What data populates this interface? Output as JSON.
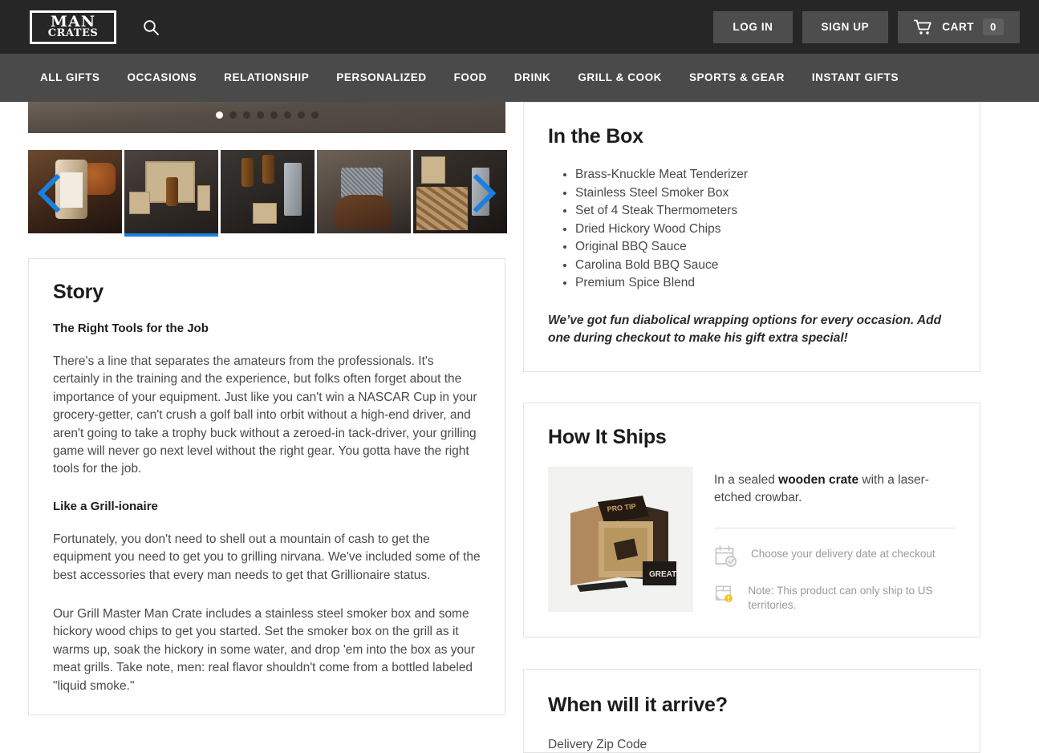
{
  "header": {
    "logo_line1": "MAN",
    "logo_line2": "CRATES",
    "search_icon": "search-icon",
    "login_label": "LOG IN",
    "signup_label": "SIGN UP",
    "cart_label": "CART",
    "cart_count": "0",
    "cart_icon": "shopping-cart-icon"
  },
  "nav": {
    "items": [
      {
        "label": "ALL GIFTS"
      },
      {
        "label": "OCCASIONS"
      },
      {
        "label": "RELATIONSHIP"
      },
      {
        "label": "PERSONALIZED"
      },
      {
        "label": "FOOD"
      },
      {
        "label": "DRINK"
      },
      {
        "label": "GRILL & COOK"
      },
      {
        "label": "SPORTS & GEAR"
      },
      {
        "label": "INSTANT GIFTS"
      }
    ]
  },
  "gallery": {
    "dot_count": 8,
    "active_dot_index": 0,
    "selected_thumb_index": 1,
    "prev_icon": "chevron-left-icon",
    "next_icon": "chevron-right-icon",
    "thumbs": [
      {
        "name": "spice-jar-with-meat"
      },
      {
        "name": "full-crate-contents"
      },
      {
        "name": "bbq-sauce-bottles-flatlay"
      },
      {
        "name": "hand-holding-meat-tenderizer"
      },
      {
        "name": "smoker-box-with-wood-chips"
      }
    ]
  },
  "story": {
    "heading": "Story",
    "sub1": "The Right Tools for the Job",
    "p1": "There's a line that separates the amateurs from the professionals. It's certainly in the training and the experience, but folks often forget about the importance of your equipment. Just like you can't win a NASCAR Cup in your grocery-getter, can't crush a golf ball into orbit without a high-end driver, and aren't going to take a trophy buck without a zeroed-in tack-driver, your grilling game will never go next level without the right gear. You gotta have the right tools for the job.",
    "sub2": "Like a Grill-ionaire",
    "p2": "Fortunately, you don't need to shell out a mountain of cash to get the equipment you need to get you to grilling nirvana. We've included some of the best accessories that every man needs to get that Grillionaire status.",
    "p3": "Our Grill Master Man Crate includes a stainless steel smoker box and some hickory wood chips to get you started. Set the smoker box on the grill as it warms up, soak the hickory in some water, and drop 'em into the box as your meat grills. Take note, men: real flavor shouldn't come from a bottled labeled \"liquid smoke.\""
  },
  "in_the_box": {
    "heading": "In the Box",
    "items": [
      "Brass-Knuckle Meat Tenderizer",
      "Stainless Steel Smoker Box",
      "Set of 4 Steak Thermometers",
      "Dried Hickory Wood Chips",
      "Original BBQ Sauce",
      "Carolina Bold BBQ Sauce",
      "Premium Spice Blend"
    ],
    "wrapping_note": "We’ve got fun diabolical wrapping options for every occasion. Add one during checkout to make his gift extra special!"
  },
  "how_it_ships": {
    "heading": "How It Ships",
    "image_name": "wooden-crate-in-box",
    "lead_before": "In a sealed ",
    "lead_bold": "wooden crate",
    "lead_after": " with a laser-etched crowbar.",
    "lines": [
      {
        "icon": "calendar-check-icon",
        "text": "Choose your delivery date at checkout"
      },
      {
        "icon": "box-warning-icon",
        "text": "Note: This product can only ship to US territories."
      }
    ]
  },
  "arrival": {
    "heading": "When will it arrive?",
    "zip_label": "Delivery Zip Code"
  },
  "colors": {
    "topbar": "#262626",
    "nav": "#4a4a4a",
    "accent_blue": "#1b7fe0",
    "warning_yellow": "#f5c518",
    "body_text": "#4a4a4a",
    "heading_text": "#1c1c1c"
  }
}
